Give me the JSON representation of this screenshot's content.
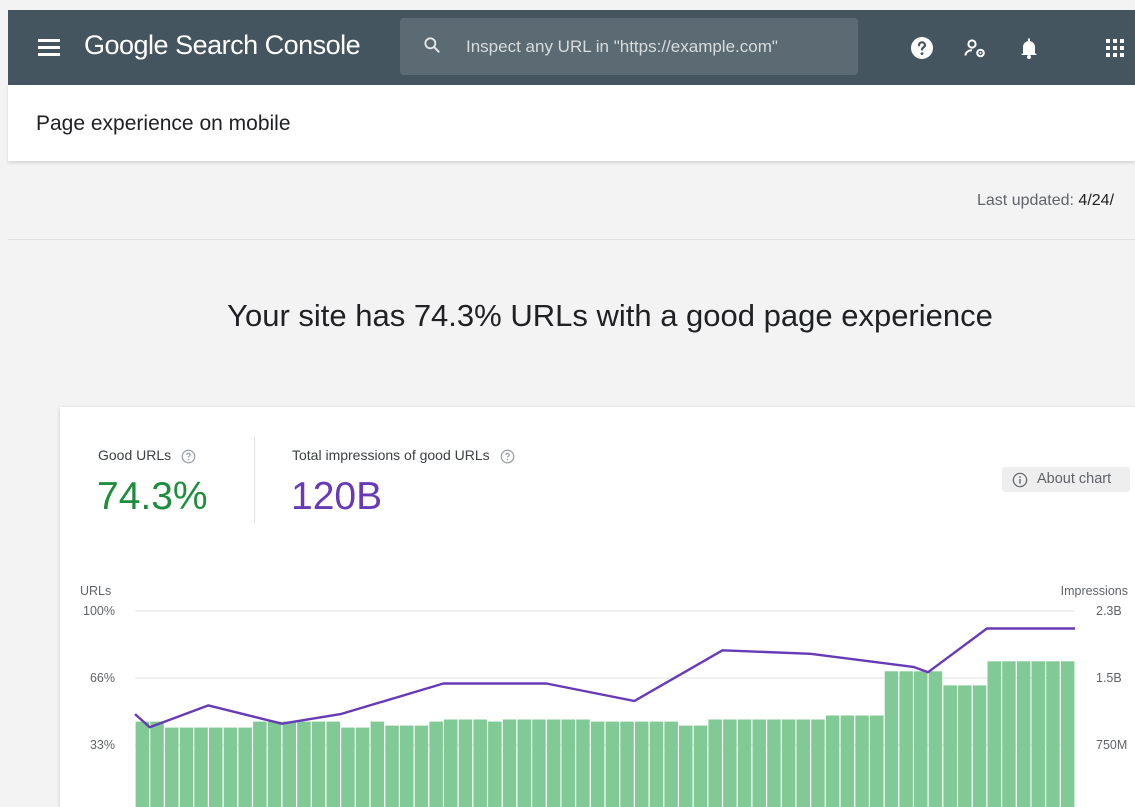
{
  "app": {
    "title": "Google Search Console"
  },
  "search": {
    "placeholder": "Inspect any URL in \"https://example.com\""
  },
  "page": {
    "title": "Page experience on mobile"
  },
  "status": {
    "last_updated_label": "Last updated:",
    "last_updated_value": "4/24/"
  },
  "headline": "Your site has 74.3% URLs with a good page experience",
  "metrics": {
    "good_urls": {
      "label": "Good URLs",
      "value": "74.3%",
      "color": "#1e8e3e"
    },
    "impressions": {
      "label": "Total impressions of good URLs",
      "value": "120B",
      "color": "#673ab7"
    }
  },
  "about_chart": {
    "label": "About chart"
  },
  "icons": [
    "menu-icon",
    "search-icon",
    "help-icon",
    "admin-settings-icon",
    "notifications-icon",
    "apps-icon",
    "info-icon"
  ],
  "colors": {
    "topbar": "#45555f",
    "bar": "#81c995",
    "line": "#673ab7"
  },
  "chart_data": {
    "type": "bar",
    "left_axis_title": "URLs",
    "right_axis_title": "Impressions",
    "left_ticks": [
      "100%",
      "66%",
      "33%"
    ],
    "right_ticks": [
      "2.3B",
      "1.5B",
      "750M"
    ],
    "ylim_left": [
      0,
      100
    ],
    "ylim_right": [
      0,
      2.3
    ],
    "grid": true,
    "series": [
      {
        "name": "Good URLs",
        "type": "bar",
        "values": [
          45,
          45,
          42,
          42,
          42,
          42,
          42,
          42,
          45,
          45,
          45,
          45,
          45,
          45,
          42,
          42,
          45,
          43,
          43,
          43,
          45,
          46,
          46,
          46,
          45,
          46,
          46,
          46,
          46,
          46,
          46,
          45,
          45,
          45,
          45,
          45,
          45,
          43,
          43,
          46,
          46,
          46,
          46,
          46,
          46,
          46,
          46,
          48,
          48,
          48,
          48,
          70,
          70,
          70,
          70,
          63,
          63,
          63,
          75,
          75,
          75,
          75,
          75,
          75
        ]
      },
      {
        "name": "Impressions",
        "type": "line",
        "points": [
          [
            0,
            1.12
          ],
          [
            1,
            0.97
          ],
          [
            5,
            1.22
          ],
          [
            10,
            1.01
          ],
          [
            14,
            1.12
          ],
          [
            21,
            1.47
          ],
          [
            28,
            1.47
          ],
          [
            34,
            1.27
          ],
          [
            40,
            1.85
          ],
          [
            46,
            1.81
          ],
          [
            53,
            1.66
          ],
          [
            54,
            1.6
          ],
          [
            58,
            2.1
          ],
          [
            64,
            2.1
          ]
        ]
      }
    ]
  }
}
